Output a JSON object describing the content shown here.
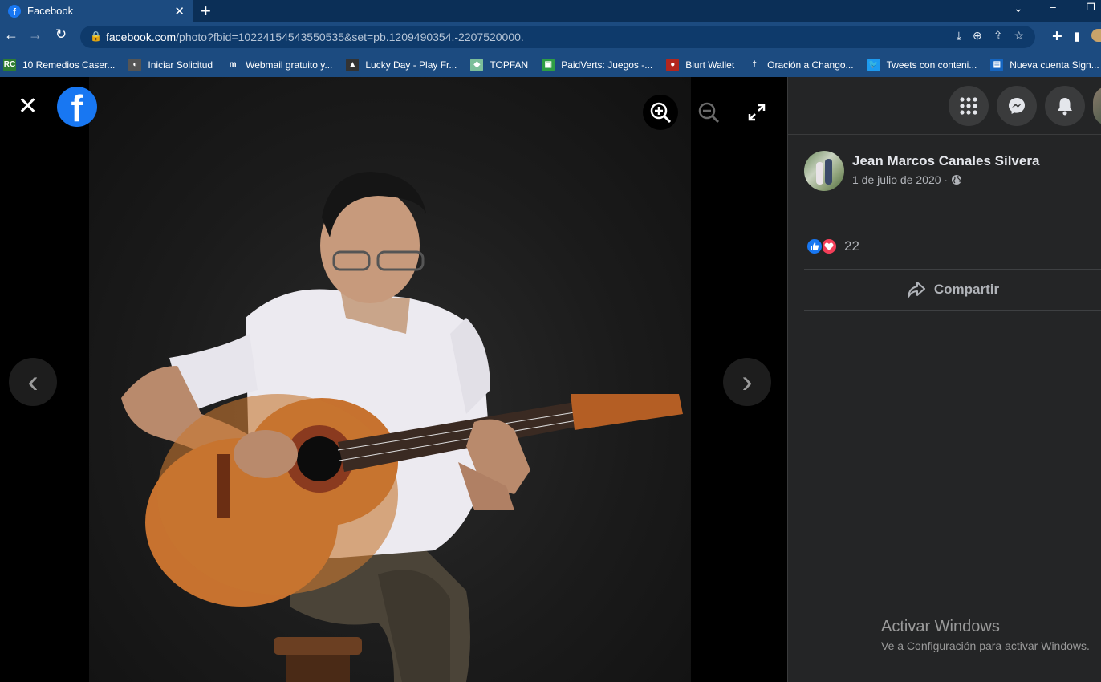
{
  "browser": {
    "tab_title": "Facebook",
    "tab_close": "✕",
    "new_tab": "+",
    "url_host": "facebook.com",
    "url_rest": "/photo?fbid=10224154543550535&set=pb.1209490354.-2207520000.",
    "bookmarks": [
      {
        "icon": "RC",
        "label": "10 Remedios Caser...",
        "color": "#2e7d32"
      },
      {
        "icon": "◐",
        "label": "Iniciar Solicitud",
        "color": "#555"
      },
      {
        "icon": "m",
        "label": "Webmail gratuito y...",
        "color": "#1c4b80"
      },
      {
        "icon": "▲",
        "label": "Lucky Day - Play Fr...",
        "color": "#333"
      },
      {
        "icon": "◆",
        "label": "TOPFAN",
        "color": "#7cbf9a"
      },
      {
        "icon": "▣",
        "label": "PaidVerts: Juegos -...",
        "color": "#2e9e44"
      },
      {
        "icon": "●",
        "label": "Blurt Wallet",
        "color": "#b3261e"
      },
      {
        "icon": "†",
        "label": "Oración a Chango...",
        "color": "#1c4b80"
      },
      {
        "icon": "🐦",
        "label": "Tweets con conteni...",
        "color": "#1d9bf0"
      },
      {
        "icon": "▤",
        "label": "Nueva cuenta Sign...",
        "color": "#1565c0"
      }
    ]
  },
  "viewer": {
    "close_glyph": "✕",
    "logo_letter": "f",
    "prev_glyph": "‹",
    "next_glyph": "›"
  },
  "sidebar": {
    "author_name": "Jean Marcos Canales Silvera",
    "date": "1 de julio de 2020 · ",
    "privacy_icon": "globe-icon",
    "reaction_count": "22",
    "share_label": "Compartir"
  },
  "watermark": {
    "title": "Activar Windows",
    "subtitle": "Ve a Configuración para activar Windows."
  }
}
